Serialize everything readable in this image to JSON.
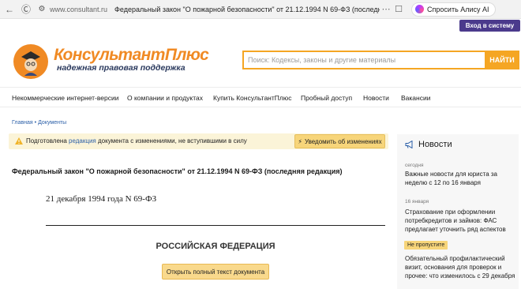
{
  "browser": {
    "domain": "www.consultant.ru",
    "page_title": "Федеральный закон \"О пожарной безопасности\" от 21.12.1994 N 69-ФЗ (последняя ред...",
    "alice_label": "Спросить Алису AI"
  },
  "header": {
    "login_label": "Вход в систему",
    "logo_name": "КонсультантПлюс",
    "logo_tagline": "надежная правовая поддержка",
    "search_placeholder": "Поиск: Кодексы, законы и другие материалы",
    "search_button": "НАЙТИ"
  },
  "nav": {
    "items": [
      "Некоммерческие интернет-версии",
      "О компании и продуктах",
      "Купить КонсультантПлюс",
      "Пробный доступ",
      "Новости",
      "Вакансии"
    ]
  },
  "breadcrumb": {
    "home": "Главная",
    "separator": "•",
    "current": "Документы"
  },
  "notice": {
    "text_before": "Подготовлена",
    "link": "редакция",
    "text_after": "документа с изменениями, не вступившими в силу",
    "button": "Уведомить об изменениях"
  },
  "document": {
    "title": "Федеральный закон \"О пожарной безопасности\" от 21.12.1994 N 69-ФЗ (последняя редакция)",
    "date_line": "21 декабря 1994 года N 69-ФЗ",
    "country": "РОССИЙСКАЯ ФЕДЕРАЦИЯ",
    "open_button": "Открыть полный текст документа"
  },
  "news": {
    "heading": "Новости",
    "items": [
      {
        "date": "сегодня",
        "text": "Важные новости для юриста за неделю с 12 по 16 января"
      },
      {
        "date": "16 января",
        "text": "Страхование при оформлении потребкредитов и займов: ФАС предлагает уточнить ряд аспектов"
      },
      {
        "badge": "Не пропустите",
        "text": "Обязательный профилактический визит, основания для проверок и прочее: что изменилось с 29 декабря"
      }
    ]
  },
  "colors": {
    "accent_orange": "#f5a623",
    "login_purple": "#4b3a8c",
    "link_blue": "#2b5fa8",
    "notice_bg": "#fbf4d8",
    "button_yellow": "#f7d57a"
  }
}
